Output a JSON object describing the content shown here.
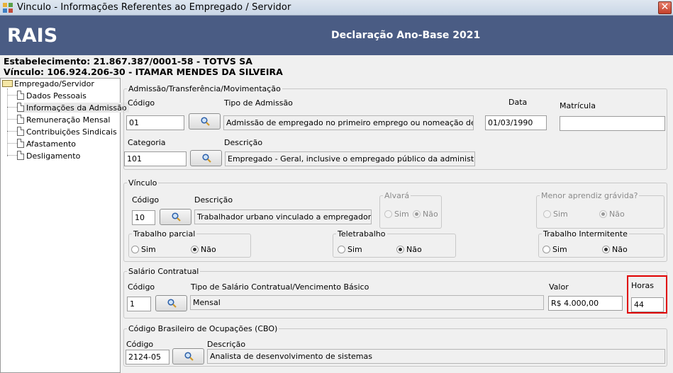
{
  "window": {
    "title": "Vinculo - Informações Referentes ao Empregado / Servidor",
    "close": "✕"
  },
  "banner": {
    "logo": "RAIS",
    "title": "Declaração Ano-Base 2021"
  },
  "header": {
    "estabelecimento": "Estabelecimento: 21.867.387/0001-58 - TOTVS SA",
    "vinculo": "Vínculo: 106.924.206-30 - ITAMAR MENDES DA SILVEIRA"
  },
  "tree": {
    "root": "Empregado/Servidor",
    "items": [
      "Dados Pessoais",
      "Informações da Admissão",
      "Remuneração Mensal",
      "Contribuições Sindicais",
      "Afastamento",
      "Desligamento"
    ],
    "selected": "Informações da Admissão"
  },
  "admissao": {
    "legend": "Admissão/Transferência/Movimentação",
    "codigo_label": "Código",
    "codigo_value": "01",
    "tipo_label": "Tipo de Admissão",
    "tipo_value": "Admissão de empregado no primeiro emprego ou nomeação de servidor em",
    "data_label": "Data",
    "data_value": "01/03/1990",
    "matricula_label": "Matrícula",
    "matricula_value": "",
    "categoria_label": "Categoria",
    "categoria_value": "101",
    "descricao_label": "Descrição",
    "descricao_value": "Empregado - Geral, inclusive o empregado público da administração direta"
  },
  "vinculo": {
    "legend": "Vínculo",
    "codigo_label": "Código",
    "codigo_value": "10",
    "descricao_label": "Descrição",
    "descricao_value": "Trabalhador urbano vinculado a empregador pessoa",
    "alvara": {
      "legend": "Alvará",
      "sim": "Sim",
      "nao": "Não"
    },
    "menor": {
      "legend": "Menor aprendiz grávida?",
      "sim": "Sim",
      "nao": "Não"
    },
    "parcial": {
      "legend": "Trabalho parcial",
      "sim": "Sim",
      "nao": "Não"
    },
    "teletrabalho": {
      "legend": "Teletrabalho",
      "sim": "Sim",
      "nao": "Não"
    },
    "intermitente": {
      "legend": "Trabalho Intermitente",
      "sim": "Sim",
      "nao": "Não"
    }
  },
  "salario": {
    "legend": "Salário Contratual",
    "codigo_label": "Código",
    "codigo_value": "1",
    "tipo_label": "Tipo de Salário Contratual/Vencimento Básico",
    "tipo_value": "Mensal",
    "valor_label": "Valor",
    "valor_value": "R$ 4.000,00",
    "horas_label": "Horas",
    "horas_value": "44"
  },
  "cbo": {
    "legend": "Código Brasileiro de Ocupações (CBO)",
    "codigo_label": "Código",
    "codigo_value": "2124-05",
    "descricao_label": "Descrição",
    "descricao_value": "Analista de desenvolvimento de sistemas"
  },
  "colors": {
    "banner": "#4a5c84",
    "highlight": "#e00000"
  },
  "icons": [
    "app-icon",
    "close-icon",
    "search-icon",
    "folder-icon",
    "document-icon"
  ]
}
